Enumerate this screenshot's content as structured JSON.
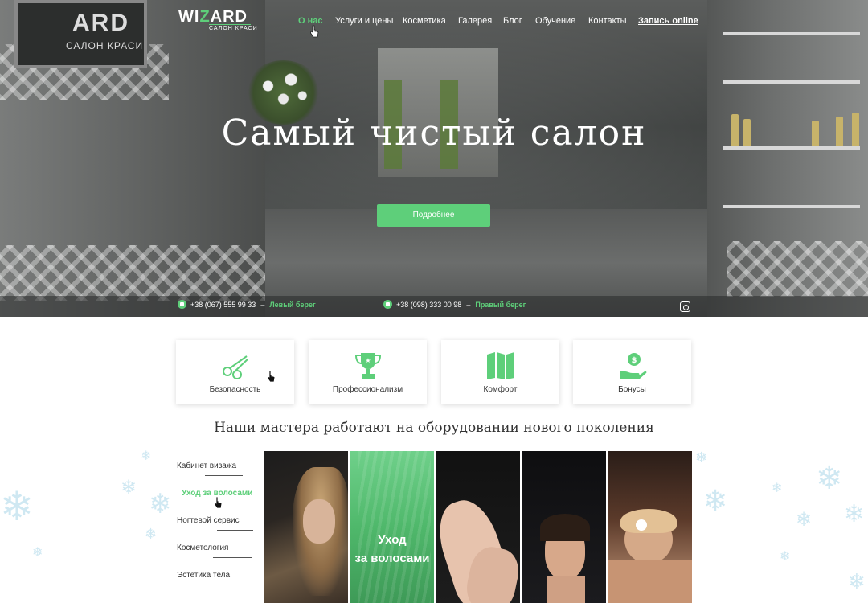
{
  "logo": {
    "text_pre": "WI",
    "text_accent": "Z",
    "text_post": "ARD",
    "subtitle": "САЛОН КРАСИ"
  },
  "nav": {
    "items": [
      "О нас",
      "Услуги и цены",
      "Косметика",
      "Галерея",
      "Блог",
      "Обучение",
      "Контакты"
    ],
    "active_index": 0,
    "cta": "Запись online"
  },
  "hero": {
    "title": "Самый чистый салон",
    "button": "Подробнее",
    "sign_text": "ARD",
    "sign_subtitle": "САЛОН КРАСИ"
  },
  "contacts": [
    {
      "phone": "+38 (067) 555 99 33",
      "shore": "Левый берег"
    },
    {
      "phone": "+38 (098) 333 00 98",
      "shore": "Правый берег"
    }
  ],
  "features": [
    {
      "label": "Безопасность",
      "icon": "scissors-icon"
    },
    {
      "label": "Профессионализм",
      "icon": "trophy-icon"
    },
    {
      "label": "Комфорт",
      "icon": "map-icon"
    },
    {
      "label": "Бонусы",
      "icon": "money-hand-icon"
    }
  ],
  "section_title": "Наши мастера работают на оборудовании нового поколения",
  "services": [
    "Кабинет визажа",
    "Уход за волосами",
    "Ногтевой сервис",
    "Косметология",
    "Эстетика тела"
  ],
  "services_active_index": 1,
  "gallery": {
    "caption_line1": "Уход",
    "caption_line2": "за волосами"
  },
  "colors": {
    "accent": "#5ecf7a",
    "text": "#333333"
  }
}
